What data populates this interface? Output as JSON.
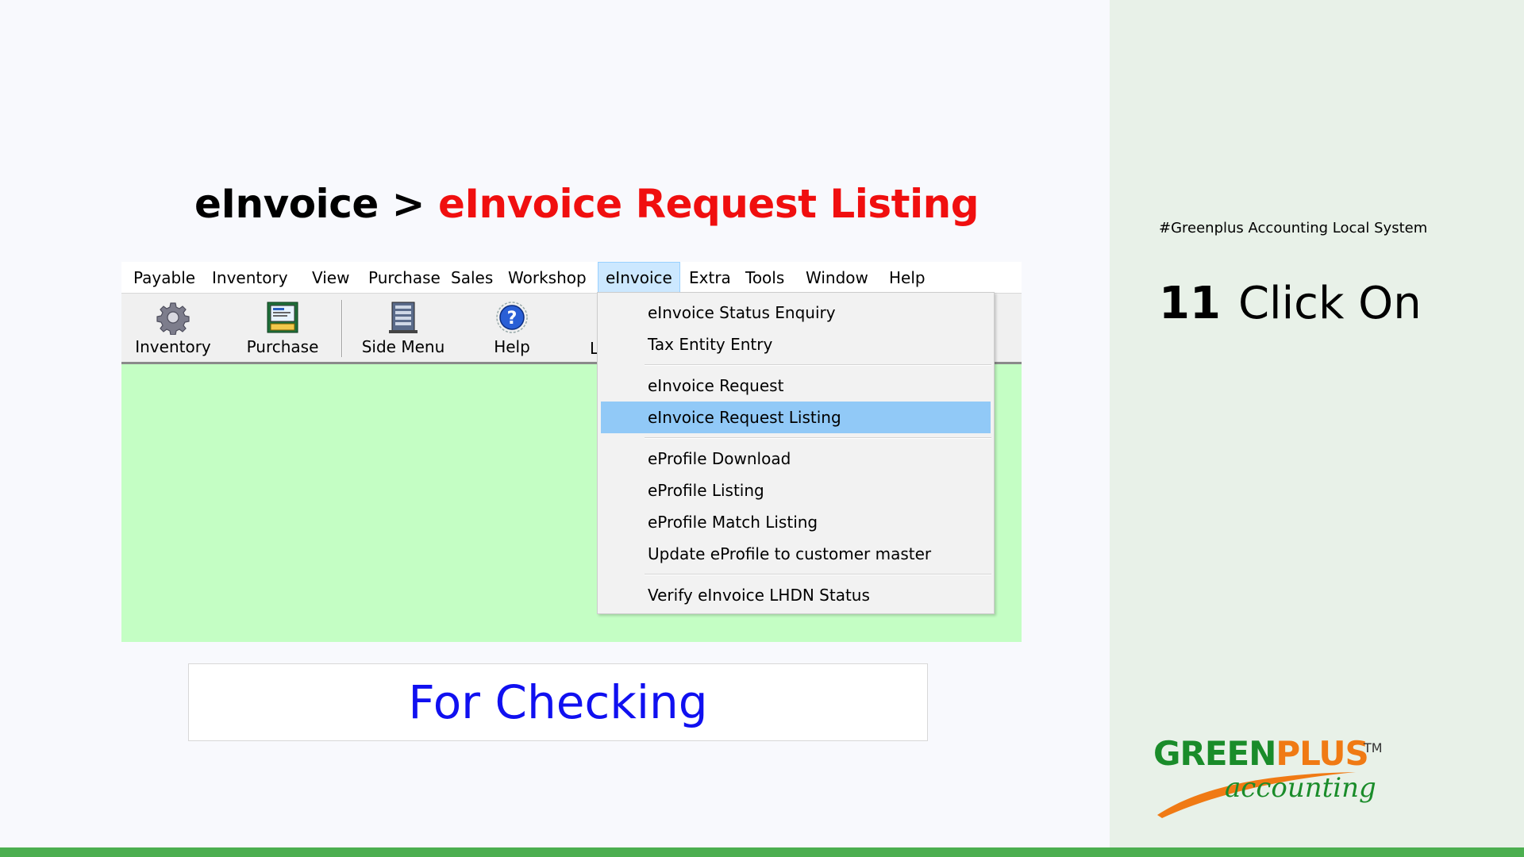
{
  "slide": {
    "title_prefix": "eInvoice > ",
    "title_highlight": "eInvoice Request Listing",
    "checking_label": "For Checking",
    "hashtag": "#Greenplus Accounting Local System",
    "step_number": "11",
    "step_text": "Click On"
  },
  "menubar": {
    "items": [
      {
        "label": "Payable"
      },
      {
        "label": "Inventory"
      },
      {
        "label": "View"
      },
      {
        "label": "Purchase"
      },
      {
        "label": "Sales"
      },
      {
        "label": "Workshop"
      },
      {
        "label": "eInvoice",
        "active": true
      },
      {
        "label": "Extra"
      },
      {
        "label": "Tools"
      },
      {
        "label": "Window"
      },
      {
        "label": "Help"
      }
    ]
  },
  "toolbar": {
    "buttons": [
      {
        "label": "Inventory",
        "icon": "gear-icon"
      },
      {
        "label": "Purchase",
        "icon": "purchase-icon"
      },
      {
        "label": "Side Menu",
        "icon": "side-menu-icon"
      },
      {
        "label": "Help",
        "icon": "help-icon"
      }
    ],
    "partial_label": "L"
  },
  "dropdown": {
    "items": [
      {
        "label": "eInvoice Status Enquiry"
      },
      {
        "label": "Tax Entity Entry"
      },
      {
        "label": "eInvoice Request"
      },
      {
        "label": "eInvoice Request Listing",
        "highlighted": true
      },
      {
        "label": "eProfile Download"
      },
      {
        "label": "eProfile Listing"
      },
      {
        "label": "eProfile Match Listing"
      },
      {
        "label": "Update eProfile to customer master"
      },
      {
        "label": "Verify eInvoice LHDN Status"
      }
    ]
  },
  "logo": {
    "brand_green": "GREEN",
    "brand_orange": "PLUS",
    "trademark": "TM",
    "sub": "accounting"
  },
  "colors": {
    "title_highlight": "#f00f0f",
    "checking_text": "#1010f0",
    "app_background": "#c4fec4",
    "menu_highlight": "#91c9f7",
    "right_panel": "#e8f1e8",
    "bottom_bar": "#4caf50",
    "brand_green": "#1a8c2a",
    "brand_orange": "#f07a14"
  }
}
